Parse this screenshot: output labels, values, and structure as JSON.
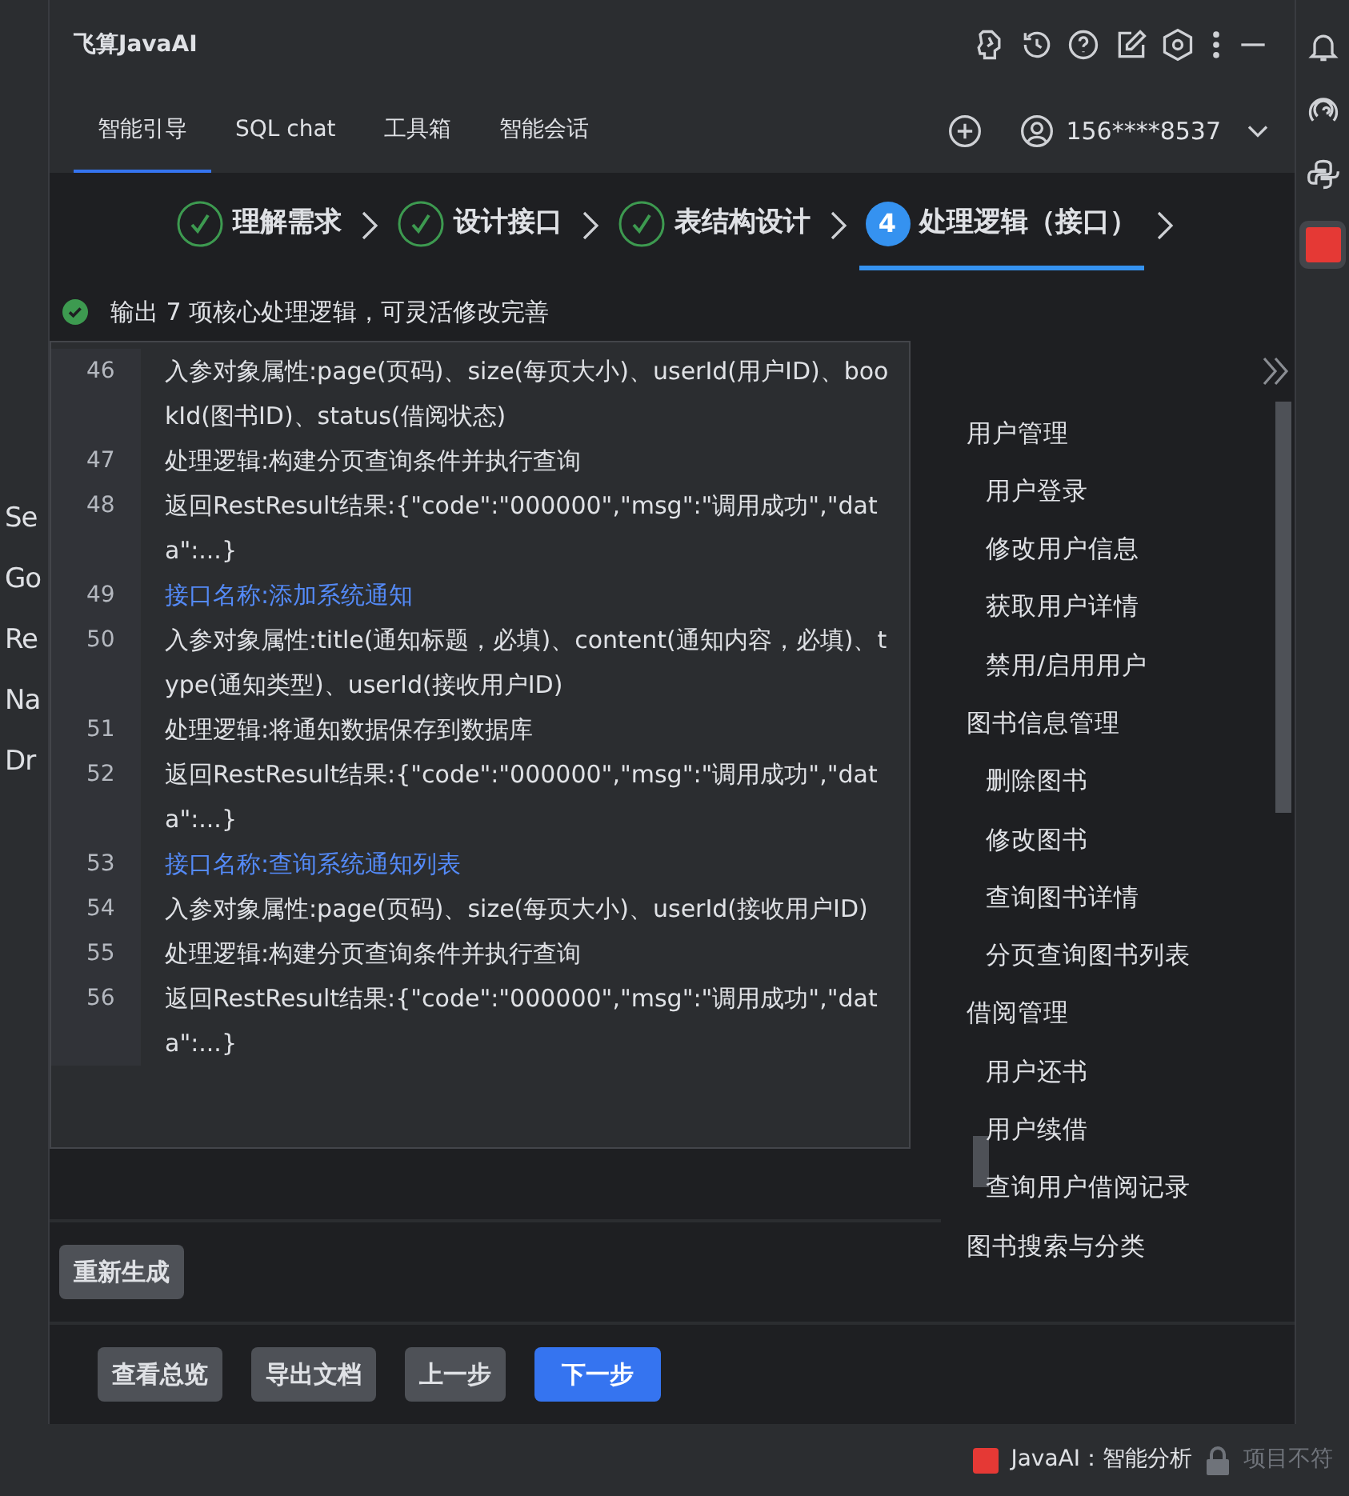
{
  "left_editor": {
    "lines": [
      "Se",
      "Go",
      "Re",
      "Na",
      "Dr"
    ]
  },
  "window": {
    "title": "飞算JavaAI"
  },
  "tabs": [
    {
      "label": "智能引导",
      "selected": true
    },
    {
      "label": "SQL chat",
      "selected": false
    },
    {
      "label": "工具箱",
      "selected": false
    },
    {
      "label": "智能会话",
      "selected": false
    }
  ],
  "account": {
    "label": "156****8537"
  },
  "steps": [
    {
      "label": "理解需求",
      "done": true,
      "selected": false
    },
    {
      "label": "设计接口",
      "done": true,
      "selected": false
    },
    {
      "label": "表结构设计",
      "done": true,
      "selected": false
    },
    {
      "number": "4",
      "label": "处理逻辑（接口）",
      "done": false,
      "selected": true
    }
  ],
  "notice": "输出 7 项核心处理逻辑，可灵活修改完善",
  "code_lines": [
    {
      "number": "46",
      "kind": "text",
      "text": "入参对象属性:page(页码)、size(每页大小)、userId(用户ID)、bookId(图书ID)、status(借阅状态)"
    },
    {
      "number": "47",
      "kind": "text",
      "text": "处理逻辑:构建分页查询条件并执行查询"
    },
    {
      "number": "48",
      "kind": "text",
      "text": "返回RestResult结果:{\"code\":\"000000\",\"msg\":\"调用成功\",\"data\":...}"
    },
    {
      "number": "49",
      "kind": "heading",
      "text": "接口名称:添加系统通知"
    },
    {
      "number": "50",
      "kind": "text",
      "text": "入参对象属性:title(通知标题，必填)、content(通知内容，必填)、type(通知类型)、userId(接收用户ID)"
    },
    {
      "number": "51",
      "kind": "text",
      "text": "处理逻辑:将通知数据保存到数据库"
    },
    {
      "number": "52",
      "kind": "text",
      "text": "返回RestResult结果:{\"code\":\"000000\",\"msg\":\"调用成功\",\"data\":...}"
    },
    {
      "number": "53",
      "kind": "heading",
      "text": "接口名称:查询系统通知列表"
    },
    {
      "number": "54",
      "kind": "text",
      "text": "入参对象属性:page(页码)、size(每页大小)、userId(接收用户ID)"
    },
    {
      "number": "55",
      "kind": "text",
      "text": "处理逻辑:构建分页查询条件并执行查询"
    },
    {
      "number": "56",
      "kind": "text",
      "text": "返回RestResult结果:{\"code\":\"000000\",\"msg\":\"调用成功\",\"data\":...}"
    }
  ],
  "regenerate_button": "重新生成",
  "outline": [
    {
      "label": "用户管理",
      "children": [
        {
          "label": "用户登录"
        },
        {
          "label": "修改用户信息"
        },
        {
          "label": "获取用户详情"
        },
        {
          "label": "禁用/启用用户"
        }
      ]
    },
    {
      "label": "图书信息管理",
      "children": [
        {
          "label": "删除图书"
        },
        {
          "label": "修改图书"
        },
        {
          "label": "查询图书详情"
        },
        {
          "label": "分页查询图书列表"
        }
      ]
    },
    {
      "label": "借阅管理",
      "children": [
        {
          "label": "用户还书"
        },
        {
          "label": "用户续借"
        },
        {
          "label": "查询用户借阅记录"
        }
      ]
    },
    {
      "label": "图书搜索与分类"
    }
  ],
  "footer_buttons": [
    {
      "label": "查看总览",
      "kind": "secondary"
    },
    {
      "label": "导出文档",
      "kind": "secondary"
    },
    {
      "label": "上一步",
      "kind": "secondary"
    },
    {
      "label": "下一步",
      "kind": "primary"
    }
  ],
  "status_bar": {
    "plugin": "JavaAI：智能分析",
    "status": "项目不符"
  }
}
